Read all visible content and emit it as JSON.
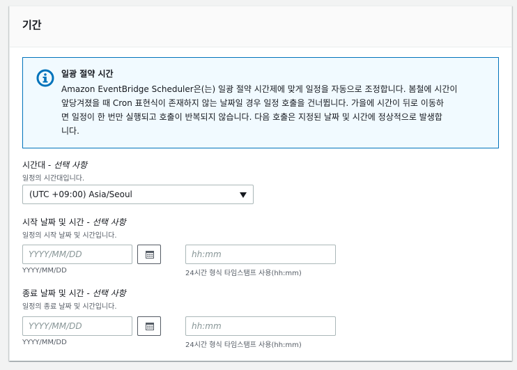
{
  "section": {
    "title": "기간"
  },
  "alert": {
    "icon": "info-icon",
    "title": "일광 절약 시간",
    "line1": "Amazon EventBridge Scheduler은(는) 일광 절약 시간제에 맞게 일정을 자동으로 조정합니다. 봄철에 시간이",
    "line2": "앞당겨졌을 때 Cron 표현식이 존재하지 않는 날짜일 경우 일정 호출을 건너뜁니다. 가을에 시간이 뒤로 이동하",
    "line3": "면 일정이 한 번만 실행되고 호출이 반복되지 않습니다. 다음 호출은 지정된 날짜 및 시간에 정상적으로 발생합",
    "line4": "니다."
  },
  "timezone": {
    "label": "시간대 - ",
    "optional": "선택 사항",
    "description": "일정의 시간대입니다.",
    "selected": "(UTC +09:00) Asia/Seoul"
  },
  "start": {
    "label": "시작 날짜 및 시간 - ",
    "optional": "선택 사항",
    "description": "일정의 시작 날짜 및 시간입니다.",
    "date_placeholder": "YYYY/MM/DD",
    "date_hint": "YYYY/MM/DD",
    "time_placeholder": "hh:mm",
    "time_hint": "24시간 형식 타임스탬프 사용(hh:mm)"
  },
  "end": {
    "label": "종료 날짜 및 시간 - ",
    "optional": "선택 사항",
    "description": "일정의 종료 날짜 및 시간입니다.",
    "date_placeholder": "YYYY/MM/DD",
    "date_hint": "YYYY/MM/DD",
    "time_placeholder": "hh:mm",
    "time_hint": "24시간 형식 타임스탬프 사용(hh:mm)"
  },
  "colors": {
    "info_blue": "#0073bb",
    "alert_bg": "#f1faff",
    "text": "#16191f",
    "secondary_text": "#545b64"
  }
}
